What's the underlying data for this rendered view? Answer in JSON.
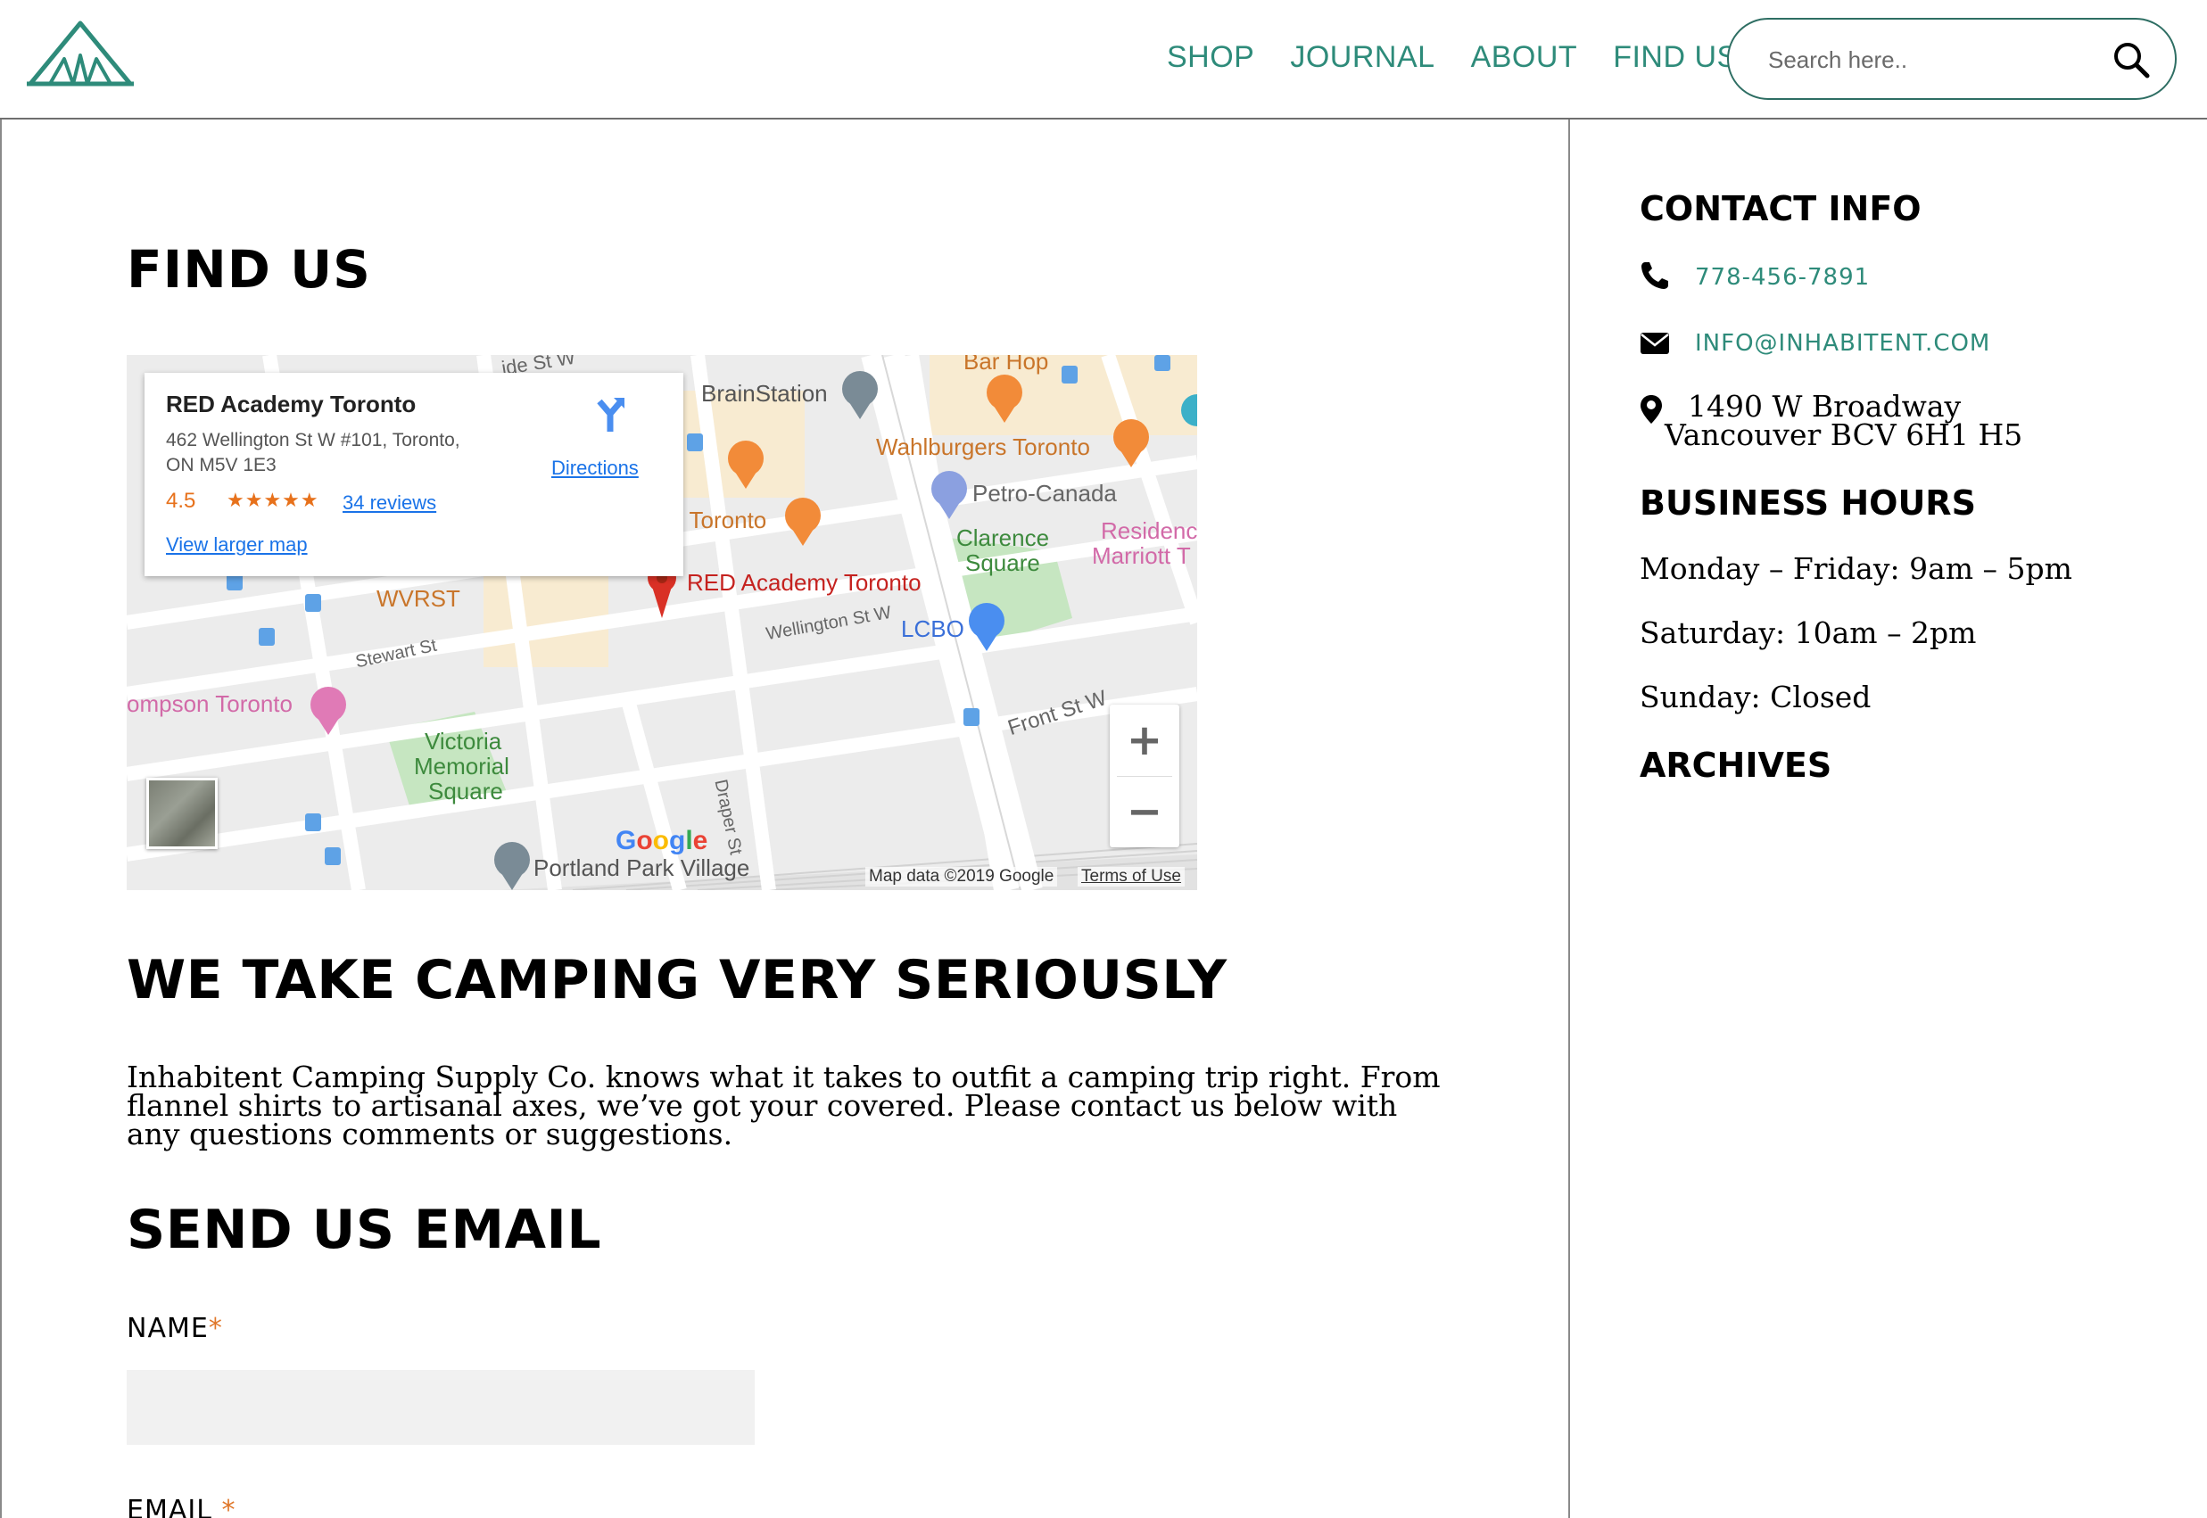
{
  "header": {
    "nav": [
      "SHOP",
      "JOURNAL",
      "ABOUT",
      "FIND US"
    ],
    "search_placeholder": "Search here.."
  },
  "main": {
    "title": "FIND US",
    "section_title": "WE TAKE CAMPING VERY SERIOUSLY",
    "intro": "Inhabitent Camping Supply Co. knows what it takes to outfit a camping trip right. From flannel shirts to artisanal axes, we’ve got your covered. Please contact us below with any questions comments or suggestions.",
    "form_title": "SEND US EMAIL",
    "name_label": "NAME",
    "email_label": "EMAIL",
    "required_mark": "*"
  },
  "map": {
    "card": {
      "place": "RED Academy Toronto",
      "address_line1": "462 Wellington St W #101, Toronto,",
      "address_line2": "ON M5V 1E3",
      "rating": "4.5",
      "stars": "★★★★★",
      "reviews": "34 reviews",
      "directions": "Directions",
      "view_larger": "View larger map"
    },
    "labels": {
      "brainstation": "BrainStation",
      "bar_hop": "Bar Hop",
      "wahlburgers": "Wahlburgers Toronto",
      "petro": "Petro-Canada",
      "clarence1": "Clarence",
      "clarence2": "Square",
      "residence1": "Residenc",
      "residence2": "Marriott T",
      "toronto": "l Toronto",
      "red_marker": "RED Academy Toronto",
      "wvrst": "WVRST",
      "lcbo": "LCBO",
      "wellington": "Wellington St W",
      "stewart": "Stewart St",
      "front": "Front St W",
      "thompson": "ompson Toronto",
      "victoria1": "Victoria",
      "victoria2": "Memorial",
      "victoria3": "Square",
      "draper": "Draper St",
      "portland": "Portland Park Village",
      "side_st": "ide St W",
      "google": "Google",
      "map_data": "Map data ©2019 Google",
      "terms": "Terms of Use"
    },
    "zoom_in": "+",
    "zoom_out": "−"
  },
  "sidebar": {
    "contact_title": "CONTACT INFO",
    "phone": "778-456-7891",
    "email": "INFO@INHABITENT.COM",
    "address_line1": "1490 W Broadway",
    "address_line2": "Vancouver BCV 6H1 H5",
    "hours_title": "BUSINESS HOURS",
    "hours": [
      "Monday – Friday: 9am – 5pm",
      "Saturday: 10am – 2pm",
      "Sunday: Closed"
    ],
    "archives_title": "ARCHIVES"
  },
  "colors": {
    "accent": "#2e8b7a",
    "required": "#e0772a",
    "link_blue": "#1a73e8"
  }
}
